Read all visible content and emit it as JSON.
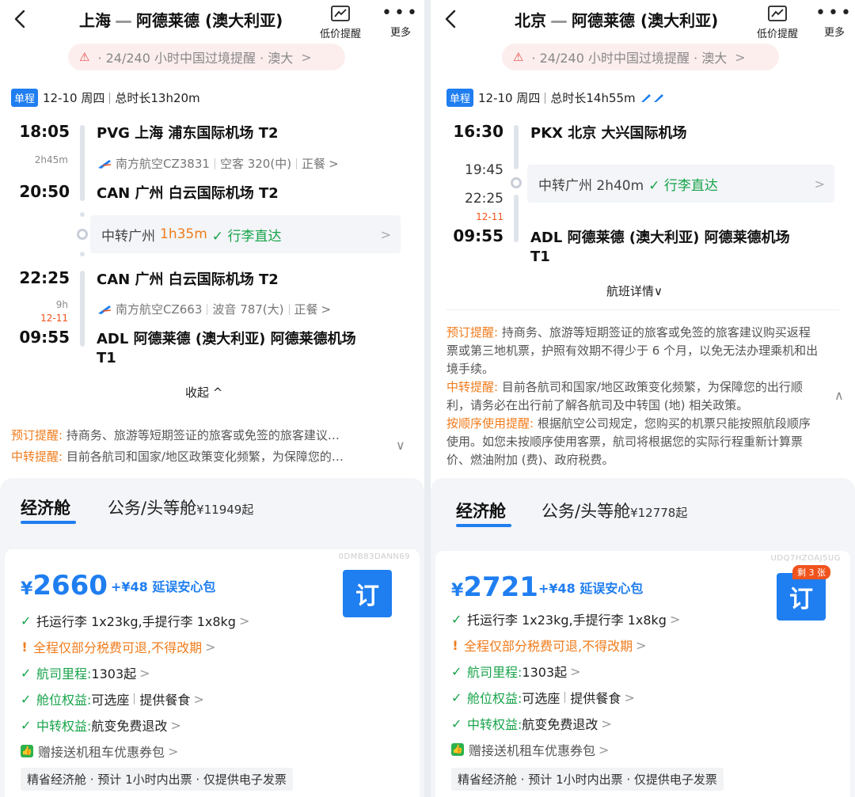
{
  "colors": {
    "brand_blue": "#1f7ef0",
    "orange": "#f07c1c",
    "green": "#17a34a",
    "red": "#f0531c"
  },
  "left": {
    "route_from": "上海",
    "route_to": "阿德莱德 (澳大利亚)",
    "low_price_label": "低价提醒",
    "more_label": "更多",
    "banner_text": "· 24/240 小时中国过境提醒 · 澳大",
    "trip_tag": "单程",
    "date": "12-10 周四",
    "total": "总时长13h20m",
    "seg1_dep_time": "18:05",
    "seg1_dur": "2h45m",
    "seg1_arr_time": "20:50",
    "seg1_dep_airport": "PVG  上海 浦东国际机场 T2",
    "seg1_info_airline": "南方航空CZ3831",
    "seg1_info_plane": "空客 320(中)",
    "seg1_info_meal": "正餐",
    "seg1_arr_airport": "CAN  广州 白云国际机场 T2",
    "transfer_label": "中转广州",
    "transfer_time": "1h35m",
    "transfer_baggage": "✓ 行李直达",
    "seg2_dep_time": "22:25",
    "seg2_dur": "9h",
    "seg2_dayshift": "12-11",
    "seg2_arr_time": "09:55",
    "seg2_dep_airport": "CAN  广州 白云国际机场 T2",
    "seg2_info_airline": "南方航空CZ663",
    "seg2_info_plane": "波音 787(大)",
    "seg2_info_meal": "正餐",
    "seg2_arr_airport": "ADL  阿德莱德 (澳大利亚) 阿德莱德机场",
    "seg2_arr_terminal": "T1",
    "collapse_label": "收起 ^",
    "notice1_label": "预订提醒:",
    "notice1_text": " 持商务、旅游等短期签证的旅客或免签的旅客建议…",
    "notice2_label": "中转提醒:",
    "notice2_text": " 目前各航司和国家/地区政策变化频繁，为保障您的…",
    "tab_econ": "经济舱",
    "tab_biz": "公务/头等舱",
    "tab_biz_price": "¥11949起",
    "code": "0DMB83DANN69",
    "price_yen": "¥",
    "price": "2660",
    "addon": "+¥48 延误安心包",
    "book": "订",
    "f1": "托运行李 1x23kg,手提行李 1x8kg",
    "f2": "全程仅部分税费可退,不得改期",
    "f3_label": "航司里程:",
    "f3_value": " 1303起",
    "f4_label": "舱位权益:",
    "f4_v1": " 可选座",
    "f4_v2": "提供餐食",
    "f5_label": "中转权益:",
    "f5_value": " 航变免费退改",
    "f6": "赠接送机租车优惠券包",
    "bottom": "精省经济舱 · 预计 1小时内出票 · 仅提供电子发票"
  },
  "right": {
    "route_from": "北京",
    "route_to": "阿德莱德 (澳大利亚)",
    "low_price_label": "低价提醒",
    "more_label": "更多",
    "banner_text": "· 24/240 小时中国过境提醒 · 澳大",
    "trip_tag": "单程",
    "date": "12-10 周四",
    "total": "总时长14h55m",
    "dep_time": "16:30",
    "dep_airport": "PKX  北京 大兴国际机场",
    "t1": "19:45",
    "transfer_label": "中转广州 2h40m",
    "transfer_baggage": "✓ 行李直达",
    "t2": "22:25",
    "dayshift": "12-11",
    "arr_time": "09:55",
    "arr_airport": "ADL  阿德莱德 (澳大利亚) 阿德莱德机场",
    "arr_terminal": "T1",
    "details_label": "航班详情∨",
    "n1_label": "预订提醒:",
    "n1_text": " 持商务、旅游等短期签证的旅客或免签的旅客建议购买返程票或第三地机票，护照有效期不得少于 6 个月，以免无法办理乘机和出境手续。",
    "n2_label": "中转提醒:",
    "n2_text": " 目前各航司和国家/地区政策变化频繁，为保障您的出行顺利，请务必在出行前了解各航司及中转国 (地) 相关政策。",
    "n3_label": "按顺序使用提醒:",
    "n3_text": " 根据航空公司规定，您购买的机票只能按照航段顺序使用。如您未按顺序使用客票，航司将根据您的实际行程重新计算票价、燃油附加 (费)、政府税费。",
    "tab_econ": "经济舱",
    "tab_biz": "公务/头等舱",
    "tab_biz_price": "¥12778起",
    "code": "UDQ7HZOAJ5UG",
    "price_yen": "¥",
    "price": "2721",
    "addon": "+¥48 延误安心包",
    "book": "订",
    "badge": "剩 3 张",
    "f1": "托运行李 1x23kg,手提行李 1x8kg",
    "f2": "全程仅部分税费可退,不得改期",
    "f3_label": "航司里程:",
    "f3_value": " 1303起",
    "f4_label": "舱位权益:",
    "f4_v1": " 可选座",
    "f4_v2": "提供餐食",
    "f5_label": "中转权益:",
    "f5_value": " 航变免费退改",
    "f6": "赠接送机租车优惠券包",
    "bottom": "精省经济舱 · 预计 1小时内出票 · 仅提供电子发票"
  }
}
